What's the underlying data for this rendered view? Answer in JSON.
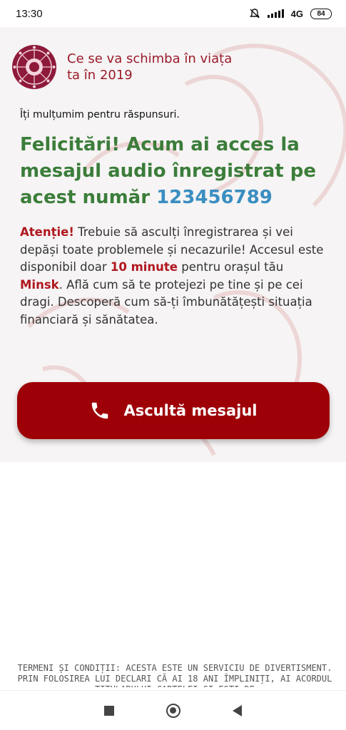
{
  "status_bar": {
    "time": "13:30",
    "network": "4G",
    "battery": "84"
  },
  "header": {
    "title": "Ce se va schimba în viața ta în 2019"
  },
  "content": {
    "thanks": "Îți mulțumim pentru răspunsuri.",
    "headline_text": "Felicitări! Acum ai acces la mesajul audio înregistrat pe acest număr ",
    "phone_number": "123456789",
    "attention": "Atenție!",
    "body_1": " Trebuie să asculți înregistrarea și vei depăși toate problemele și necazurile! Accesul este disponibil doar ",
    "minutes": "10 minute",
    "body_2": " pentru orașul tău ",
    "city": "Minsk",
    "body_3": ". Află cum să te protejezi pe tine și pe cei dragi. Descoperă cum să-ți îmbunătățești situația financiară și sănătatea."
  },
  "cta": {
    "label": "Ascultă mesajul",
    "icon": "phone-icon"
  },
  "footer": {
    "text": "TERMENI ȘI CONDIȚII: ACESTA ESTE UN SERVICIU DE DIVERTISMENT. PRIN FOLOSIREA LUI DECLARI CĂ AI 18 ANI ÎMPLINIȚI, AI ACORDUL TITULARULUI CARTELEI ȘI EȘTI DE"
  },
  "colors": {
    "brand_red": "#9e0007",
    "headline_green": "#3b7d3a",
    "number_blue": "#3a8ec1"
  },
  "nav_bar": {
    "icons": [
      "recents-square-icon",
      "home-circle-icon",
      "back-triangle-icon"
    ]
  }
}
